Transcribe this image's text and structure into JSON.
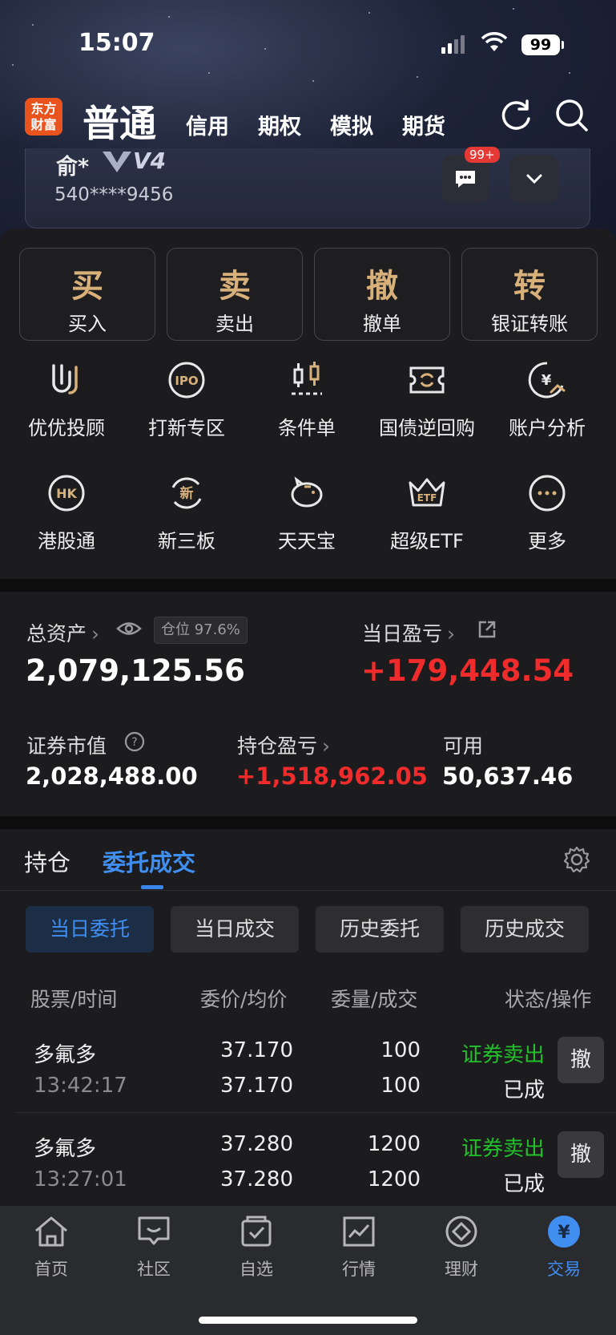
{
  "status_bar": {
    "time": "15:07",
    "battery": "99"
  },
  "header": {
    "logo_text": "东方财富",
    "tabs": [
      {
        "label": "普通"
      },
      {
        "label": "信用"
      },
      {
        "label": "期权"
      },
      {
        "label": "模拟"
      },
      {
        "label": "期货"
      }
    ],
    "icons": [
      "refresh-icon",
      "search-icon"
    ]
  },
  "account": {
    "name": "俞*",
    "level": "V4",
    "number": "540****9456",
    "message_badge": "99+"
  },
  "trade_buttons": [
    {
      "glyph": "买",
      "label": "买入"
    },
    {
      "glyph": "卖",
      "label": "卖出"
    },
    {
      "glyph": "撤",
      "label": "撤单"
    },
    {
      "glyph": "转",
      "label": "银证转账"
    }
  ],
  "grid_row1": [
    {
      "label": "优优投顾",
      "icon": "uu-advisor-icon"
    },
    {
      "label": "打新专区",
      "icon": "ipo-icon"
    },
    {
      "label": "条件单",
      "icon": "candlestick-icon"
    },
    {
      "label": "国债逆回购",
      "icon": "bond-repo-icon"
    },
    {
      "label": "账户分析",
      "icon": "yuan-analysis-icon"
    }
  ],
  "grid_row2": [
    {
      "label": "港股通",
      "icon": "hk-icon"
    },
    {
      "label": "新三板",
      "icon": "new-three-board-icon"
    },
    {
      "label": "天天宝",
      "icon": "piggy-bank-icon"
    },
    {
      "label": "超级ETF",
      "icon": "etf-crown-icon"
    },
    {
      "label": "更多",
      "icon": "more-icon"
    }
  ],
  "ipo_text": "IPO",
  "hk_text": "HK",
  "xin_text": "新",
  "etf_text": "ETF",
  "yuan_text": "¥",
  "assets": {
    "total_label": "总资产",
    "position_pill": "仓位 97.6%",
    "total_value": "2,079,125.56",
    "daily_pl_label": "当日盈亏",
    "daily_pl_value": "+179,448.54",
    "market_value_label": "证券市值",
    "market_value": "2,028,488.00",
    "holding_pl_label": "持仓盈亏",
    "holding_pl_value": "+1,518,962.05",
    "available_label": "可用",
    "available_value": "50,637.46"
  },
  "orders": {
    "tabs": [
      {
        "label": "持仓"
      },
      {
        "label": "委托成交"
      }
    ],
    "subtabs": [
      {
        "label": "当日委托"
      },
      {
        "label": "当日成交"
      },
      {
        "label": "历史委托"
      },
      {
        "label": "历史成交"
      }
    ],
    "headers": {
      "stock": "股票/时间",
      "price": "委价/均价",
      "qty": "委量/成交",
      "status": "状态/操作"
    },
    "rows": [
      {
        "name": "多氟多",
        "time": "13:42:17",
        "price": "37.170",
        "avg": "37.170",
        "qty": "100",
        "filled": "100",
        "type": "证券卖出",
        "status": "已成",
        "action": "撤"
      },
      {
        "name": "多氟多",
        "time": "13:27:01",
        "price": "37.280",
        "avg": "37.280",
        "qty": "1200",
        "filled": "1200",
        "type": "证券卖出",
        "status": "已成",
        "action": "撤"
      }
    ]
  },
  "bottom_nav": [
    {
      "label": "首页",
      "icon": "home-icon"
    },
    {
      "label": "社区",
      "icon": "community-icon"
    },
    {
      "label": "自选",
      "icon": "watchlist-icon"
    },
    {
      "label": "行情",
      "icon": "market-icon"
    },
    {
      "label": "理财",
      "icon": "wealth-icon"
    },
    {
      "label": "交易",
      "icon": "trade-icon",
      "symbol": "¥"
    }
  ],
  "colors": {
    "accent": "#3f8ef0",
    "gain": "#ef2b2b",
    "sell": "#22c02a",
    "gold": "#d8b07a",
    "brand": "#e9531e"
  }
}
